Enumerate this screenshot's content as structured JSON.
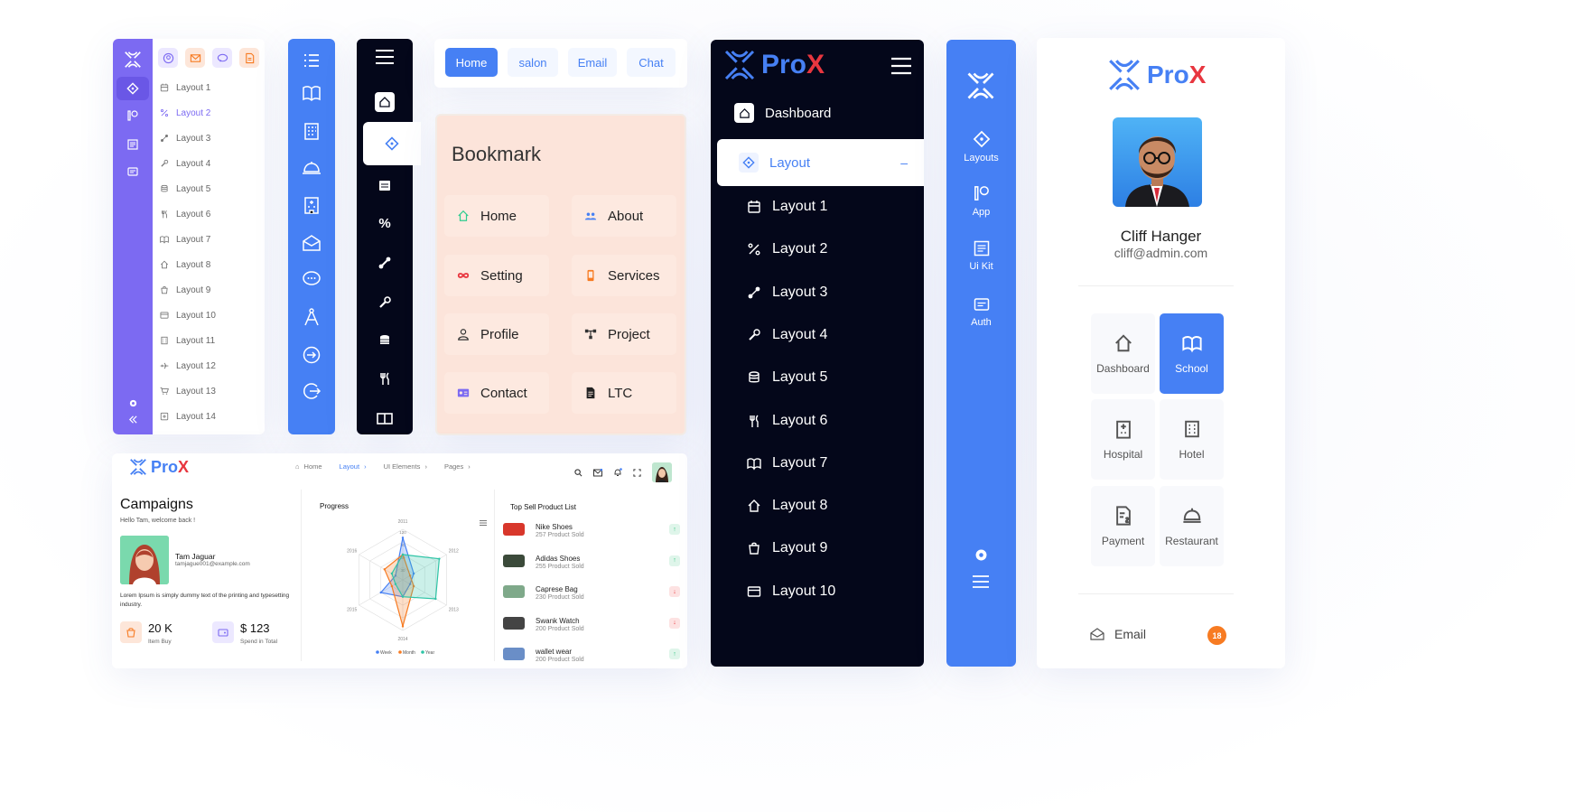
{
  "colors": {
    "primary": "#4680f4",
    "purple": "#7c6af2",
    "dark": "#04071a",
    "accent_red": "#e8363f",
    "badge": "#f77b22"
  },
  "panel_purple": {
    "items": [
      {
        "label": "Layout 1",
        "icon": "calendar-icon"
      },
      {
        "label": "Layout 2",
        "icon": "percent-icon"
      },
      {
        "label": "Layout 3",
        "icon": "link-icon"
      },
      {
        "label": "Layout 4",
        "icon": "wrench-icon"
      },
      {
        "label": "Layout 5",
        "icon": "coins-icon"
      },
      {
        "label": "Layout 6",
        "icon": "cutlery-icon"
      },
      {
        "label": "Layout 7",
        "icon": "book-icon"
      },
      {
        "label": "Layout 8",
        "icon": "home-icon"
      },
      {
        "label": "Layout 9",
        "icon": "bag-icon"
      },
      {
        "label": "Layout 10",
        "icon": "card-icon"
      },
      {
        "label": "Layout 11",
        "icon": "building-icon"
      },
      {
        "label": "Layout 12",
        "icon": "plane-icon"
      },
      {
        "label": "Layout 13",
        "icon": "cart-icon"
      },
      {
        "label": "Layout 14",
        "icon": "plus-square-icon"
      }
    ]
  },
  "tabs": [
    {
      "label": "Home",
      "active": true
    },
    {
      "label": "salon"
    },
    {
      "label": "Email"
    },
    {
      "label": "Chat"
    }
  ],
  "bookmark": {
    "title": "Bookmark",
    "items": [
      {
        "label": "Home",
        "icon": "home-icon",
        "color": "#2ecc8f"
      },
      {
        "label": "About",
        "icon": "users-icon",
        "color": "#4680f4"
      },
      {
        "label": "Setting",
        "icon": "infinity-icon",
        "color": "#e8363f"
      },
      {
        "label": "Services",
        "icon": "mobile-icon",
        "color": "#f77b22"
      },
      {
        "label": "Profile",
        "icon": "user-icon",
        "color": "#333"
      },
      {
        "label": "Project",
        "icon": "sitemap-icon",
        "color": "#333"
      },
      {
        "label": "Contact",
        "icon": "id-card-icon",
        "color": "#7c6af2"
      },
      {
        "label": "LTC",
        "icon": "file-icon",
        "color": "#222"
      }
    ]
  },
  "dark_sidebar": {
    "brand": "ProX",
    "brand_accent": "X",
    "dashboard": "Dashboard",
    "layout": "Layout",
    "collapse_symbol": "–",
    "items": [
      "Layout 1",
      "Layout 2",
      "Layout 3",
      "Layout 4",
      "Layout 5",
      "Layout 6",
      "Layout 7",
      "Layout 8",
      "Layout 9",
      "Layout 10"
    ]
  },
  "blue_rail": {
    "items": [
      "Layouts",
      "App",
      "Ui Kit",
      "Auth"
    ]
  },
  "profile": {
    "brand": "Pro",
    "brand_accent": "X",
    "name": "Cliff Hanger",
    "email": "cliff@admin.com",
    "tiles": [
      {
        "label": "Dashboard",
        "icon": "home-icon"
      },
      {
        "label": "School",
        "icon": "book-icon",
        "active": true
      },
      {
        "label": "Hospital",
        "icon": "hospital-icon"
      },
      {
        "label": "Hotel",
        "icon": "building-icon"
      },
      {
        "label": "Payment",
        "icon": "invoice-icon"
      },
      {
        "label": "Restaurant",
        "icon": "cloche-icon"
      }
    ],
    "email_label": "Email",
    "email_count": "18"
  },
  "dashboard": {
    "brand": "Pro",
    "brand_accent": "X",
    "nav": [
      "Home",
      "Layout",
      "UI Elements",
      "Pages"
    ],
    "campaigns": {
      "title": "Campaigns",
      "subtitle": "Hello Tam, welcome back !",
      "user_name": "Tam Jaguar",
      "user_email": "tamjague001@example.com",
      "lorem": "Lorem Ipsum is simply dummy text of the printing and typesetting industry.",
      "stat1_value": "20 K",
      "stat1_label": "Item Buy",
      "stat2_value": "$ 123",
      "stat2_label": "Spend in Total"
    },
    "progress": {
      "title": "Progress",
      "axes": [
        "2011",
        "2012",
        "2013",
        "2014",
        "2015",
        "2016"
      ],
      "radial_ticks": [
        "120",
        "90",
        "60",
        "30"
      ],
      "legend": [
        "Week",
        "Month",
        "Year"
      ]
    },
    "products": {
      "title": "Top Sell Product List",
      "items": [
        {
          "name": "Nike Shoes",
          "sold": "257 Product Sold",
          "trend": "up"
        },
        {
          "name": "Adidas Shoes",
          "sold": "255 Product Sold",
          "trend": "up"
        },
        {
          "name": "Caprese Bag",
          "sold": "230 Product Sold",
          "trend": "down"
        },
        {
          "name": "Swank Watch",
          "sold": "200 Product Sold",
          "trend": "down"
        },
        {
          "name": "wallet wear",
          "sold": "200 Product Sold",
          "trend": "up"
        }
      ]
    }
  },
  "chart_data": {
    "type": "radar",
    "title": "Progress",
    "categories": [
      "2011",
      "2012",
      "2013",
      "2014",
      "2015",
      "2016"
    ],
    "rmax": 120,
    "series": [
      {
        "name": "Week",
        "values": [
          100,
          30,
          20,
          40,
          60,
          20
        ],
        "color": "#4680f4"
      },
      {
        "name": "Month",
        "values": [
          60,
          20,
          30,
          110,
          30,
          50
        ],
        "color": "#f77b22"
      },
      {
        "name": "Year",
        "values": [
          60,
          100,
          90,
          40,
          20,
          30
        ],
        "color": "#2ec4a6"
      }
    ]
  }
}
